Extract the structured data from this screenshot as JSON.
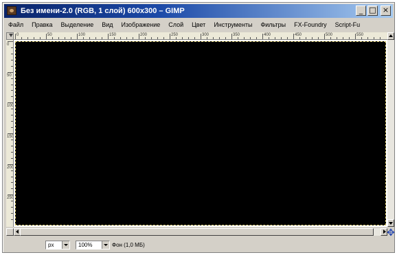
{
  "window": {
    "title": "Без имени-2.0 (RGB, 1 слой) 600x300 – GIMP",
    "minimize_symbol": "_",
    "maximize_symbol": "□",
    "close_symbol": "×"
  },
  "menubar": {
    "items": [
      {
        "label": "Файл"
      },
      {
        "label": "Правка"
      },
      {
        "label": "Выделение"
      },
      {
        "label": "Вид"
      },
      {
        "label": "Изображение"
      },
      {
        "label": "Слой"
      },
      {
        "label": "Цвет"
      },
      {
        "label": "Инструменты"
      },
      {
        "label": "Фильтры"
      },
      {
        "label": "FX-Foundry"
      },
      {
        "label": "Script-Fu"
      }
    ]
  },
  "rulers": {
    "horizontal_labels": [
      "0",
      "50",
      "100",
      "150",
      "200",
      "250",
      "300",
      "350",
      "400",
      "450",
      "500",
      "550"
    ],
    "vertical_labels": [
      "0",
      "50",
      "100",
      "150",
      "200",
      "250"
    ]
  },
  "canvas": {
    "fill_color": "#000000",
    "layer_boundary_color": "#e0d070"
  },
  "statusbar": {
    "unit": "px",
    "zoom": "100%",
    "layer_info": "Фон (1,0 МБ)"
  },
  "icons": {
    "app": "gimp-icon",
    "navigate": "navigate-icon",
    "quickmask": "quick-mask-toggle-icon"
  },
  "colors": {
    "titlebar_start": "#0a246a",
    "titlebar_end": "#a6caf0",
    "window_bg": "#d4d0c8"
  }
}
